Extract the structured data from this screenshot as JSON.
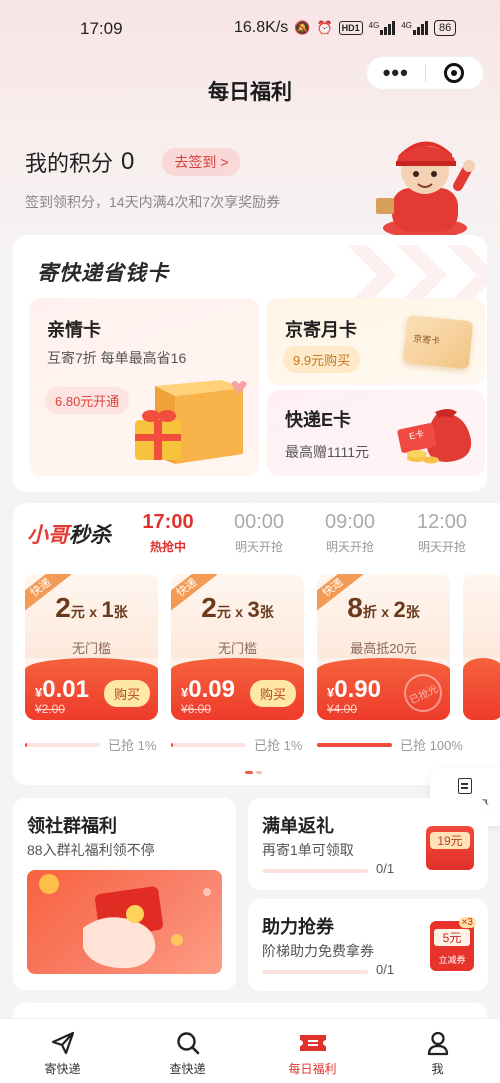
{
  "status_bar": {
    "time": "17:09",
    "speed": "16.8K/s",
    "hd": "HD1",
    "net1": "4G",
    "net2": "4G",
    "battery": "86"
  },
  "nav": {
    "title": "每日福利",
    "more_icon": "more-dots-icon",
    "close_icon": "target-close-icon"
  },
  "points": {
    "title": "我的积分",
    "value": "0",
    "checkin_label": "去签到 >",
    "desc": "签到领积分，14天内满4次和7次享奖励券"
  },
  "save_card": {
    "title": "寄快递省钱卡",
    "family": {
      "title": "亲情卡",
      "desc": "互寄7折 每单最高省16",
      "price": "6.80元开通"
    },
    "monthly": {
      "title": "京寄月卡",
      "price": "9.9元购买",
      "card_text": "京寄卡"
    },
    "ecard": {
      "title": "快递E卡",
      "desc": "最高赠1111元",
      "card_text": "E卡"
    }
  },
  "flash_sale": {
    "logo_part1": "小哥",
    "logo_part2": "秒杀",
    "tabs": [
      {
        "time": "17:00",
        "status": "热抢中"
      },
      {
        "time": "00:00",
        "status": "明天开抢"
      },
      {
        "time": "09:00",
        "status": "明天开抢"
      },
      {
        "time": "12:00",
        "status": "明天开抢"
      }
    ],
    "coupons": [
      {
        "tag": "快递",
        "num": "2",
        "unit": "元",
        "mult": "x",
        "qty": "1",
        "qty_unit": "张",
        "cond": "无门槛",
        "cur": "¥",
        "price": "0.01",
        "old": "¥2.00",
        "btn": "购买",
        "progress_pct": 1,
        "progress_text": "已抢 1%"
      },
      {
        "tag": "快递",
        "num": "2",
        "unit": "元",
        "mult": "x",
        "qty": "3",
        "qty_unit": "张",
        "cond": "无门槛",
        "cur": "¥",
        "price": "0.09",
        "old": "¥6.00",
        "btn": "购买",
        "progress_pct": 1,
        "progress_text": "已抢 1%"
      },
      {
        "tag": "快递",
        "num": "8",
        "unit": "折",
        "mult": "x",
        "qty": "2",
        "qty_unit": "张",
        "cond": "最高抵20元",
        "cur": "¥",
        "price": "0.90",
        "old": "¥4.00",
        "btn": "已抢光",
        "progress_pct": 100,
        "progress_text": "已抢 100%"
      }
    ]
  },
  "purchase_record": {
    "label": "购券记录",
    "icon": "receipt-icon"
  },
  "group_welfare": {
    "title": "领社群福利",
    "desc": "88入群礼福利领不停"
  },
  "full_return": {
    "title": "满单返礼",
    "desc": "再寄1单可领取",
    "count": "0/1",
    "badge": "19元"
  },
  "assist": {
    "title": "助力抢券",
    "desc": "阶梯助力免费拿券",
    "count": "0/1",
    "badge": "5元",
    "badge_mult": "×3",
    "badge_btn": "立减券"
  },
  "tabbar": [
    {
      "label": "寄快递",
      "icon": "paper-plane-icon"
    },
    {
      "label": "查快递",
      "icon": "search-icon"
    },
    {
      "label": "每日福利",
      "icon": "ticket-icon"
    },
    {
      "label": "我",
      "icon": "person-icon"
    }
  ],
  "colors": {
    "accent": "#e0322d",
    "brand_red": "#ee3b2c",
    "bg": "#f4f4f4"
  }
}
